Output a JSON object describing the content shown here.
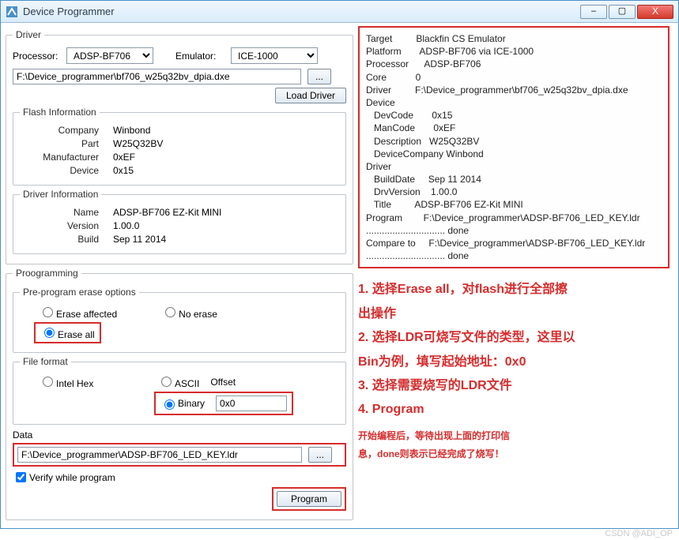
{
  "window": {
    "title": "Device Programmer"
  },
  "win_buttons": {
    "min": "–",
    "max": "▢",
    "close": "X"
  },
  "driver": {
    "legend": "Driver",
    "processor_label": "Processor:",
    "processor_value": "ADSP-BF706",
    "emulator_label": "Emulator:",
    "emulator_value": "ICE-1000",
    "path": "F:\\Device_programmer\\bf706_w25q32bv_dpia.dxe",
    "browse": "...",
    "load": "Load Driver",
    "flash_info": {
      "legend": "Flash Information",
      "company_l": "Company",
      "company_v": "Winbond",
      "part_l": "Part",
      "part_v": "W25Q32BV",
      "manuf_l": "Manufacturer",
      "manuf_v": "0xEF",
      "device_l": "Device",
      "device_v": "0x15"
    },
    "driver_info": {
      "legend": "Driver Information",
      "name_l": "Name",
      "name_v": "ADSP-BF706 EZ-Kit MINI",
      "ver_l": "Version",
      "ver_v": "1.00.0",
      "build_l": "Build",
      "build_v": "Sep 11 2014"
    }
  },
  "prog": {
    "legend": "Proogramming",
    "erase_group": "Pre-program erase options",
    "erase_affected": "Erase affected",
    "no_erase": "No erase",
    "erase_all": "Erase all",
    "file_group": "File format",
    "intel_hex": "Intel Hex",
    "ascii": "ASCII",
    "binary": "Binary",
    "offset_l": "Offset",
    "offset_v": "0x0",
    "data_l": "Data",
    "data_path": "F:\\Device_programmer\\ADSP-BF706_LED_KEY.ldr",
    "data_browse": "...",
    "verify": "Verify while program",
    "program_btn": "Program"
  },
  "console": {
    "l1": "Target         Blackfin CS Emulator",
    "l2": "Platform       ADSP-BF706 via ICE-1000",
    "l3": "Processor      ADSP-BF706",
    "l4": "Core           0",
    "l5": "Driver         F:\\Device_programmer\\bf706_w25q32bv_dpia.dxe",
    "l6": "Device",
    "l7": "   DevCode       0x15",
    "l8": "   ManCode       0xEF",
    "l9": "   Description   W25Q32BV",
    "l10": "   DeviceCompany Winbond",
    "l11": "Driver",
    "l12": "   BuildDate     Sep 11 2014",
    "l13": "   DrvVersion    1.00.0",
    "l14": "   Title         ADSP-BF706 EZ-Kit MINI",
    "l15": "Program        F:\\Device_programmer\\ADSP-BF706_LED_KEY.ldr",
    "l16": ".............................. done",
    "l17": "Compare to     F:\\Device_programmer\\ADSP-BF706_LED_KEY.ldr",
    "l18": ".............................. done"
  },
  "annotations": {
    "s1": "1. 选择Erase all，对flash进行全部擦",
    "s1b": "出操作",
    "s2": "2. 选择LDR可烧写文件的类型，这里以",
    "s2b": "Bin为例，填写起始地址：0x0",
    "s3": "3. 选择需要烧写的LDR文件",
    "s4": "4. Program",
    "f1": "开始编程后，等待出现上面的打印信",
    "f2": "息，done则表示已经完成了烧写！"
  },
  "watermark": "CSDN @ADI_OP"
}
